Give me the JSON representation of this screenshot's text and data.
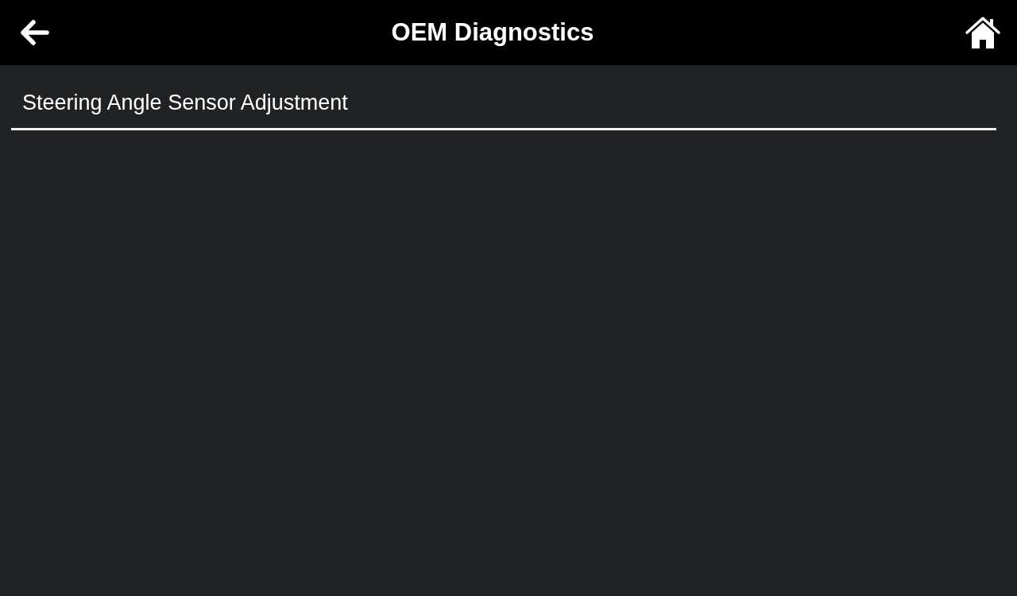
{
  "header": {
    "title": "OEM Diagnostics"
  },
  "menu": {
    "items": [
      {
        "label": "Steering Angle Sensor Adjustment"
      }
    ]
  }
}
